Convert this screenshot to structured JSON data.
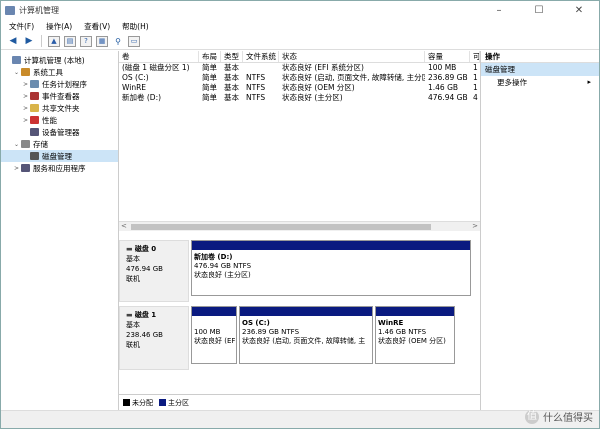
{
  "window": {
    "title": "计算机管理",
    "min": "–",
    "max": "☐",
    "close": "✕"
  },
  "menu": [
    "文件(F)",
    "操作(A)",
    "查看(V)",
    "帮助(H)"
  ],
  "tree": [
    {
      "label": "计算机管理 (本地)",
      "indent": 0,
      "exp": "",
      "color": "#6a86b0",
      "icon": "computer-icon"
    },
    {
      "label": "系统工具",
      "indent": 1,
      "exp": "⌄",
      "color": "#c98b2a",
      "icon": "tools-icon"
    },
    {
      "label": "任务计划程序",
      "indent": 2,
      "exp": ">",
      "color": "#6b8cae",
      "icon": "clock-icon"
    },
    {
      "label": "事件查看器",
      "indent": 2,
      "exp": ">",
      "color": "#a33",
      "icon": "event-icon"
    },
    {
      "label": "共享文件夹",
      "indent": 2,
      "exp": ">",
      "color": "#d9b44a",
      "icon": "folder-icon"
    },
    {
      "label": "性能",
      "indent": 2,
      "exp": ">",
      "color": "#c33",
      "icon": "performance-icon"
    },
    {
      "label": "设备管理器",
      "indent": 2,
      "exp": "",
      "color": "#557",
      "icon": "device-icon"
    },
    {
      "label": "存储",
      "indent": 1,
      "exp": "⌄",
      "color": "#888",
      "icon": "storage-icon"
    },
    {
      "label": "磁盘管理",
      "indent": 2,
      "exp": "",
      "color": "#555",
      "icon": "disk-icon",
      "selected": true
    },
    {
      "label": "服务和应用程序",
      "indent": 1,
      "exp": ">",
      "color": "#557",
      "icon": "services-icon"
    }
  ],
  "volume_headers": [
    "卷",
    "布局",
    "类型",
    "文件系统",
    "状态",
    "容量",
    "可"
  ],
  "volumes": [
    [
      "(磁盘 1 磁盘分区 1)",
      "简单",
      "基本",
      "",
      "状态良好 (EFI 系统分区)",
      "100 MB",
      "1"
    ],
    [
      "OS (C:)",
      "简单",
      "基本",
      "NTFS",
      "状态良好 (启动, 页面文件, 故障转储, 主分区)",
      "236.89 GB",
      "1"
    ],
    [
      "WinRE",
      "简单",
      "基本",
      "NTFS",
      "状态良好 (OEM 分区)",
      "1.46 GB",
      "1"
    ],
    [
      "新加卷 (D:)",
      "简单",
      "基本",
      "NTFS",
      "状态良好 (主分区)",
      "476.94 GB",
      "4"
    ]
  ],
  "disks": [
    {
      "name": "磁盘 0",
      "type": "基本",
      "size": "476.94 GB",
      "status": "联机",
      "partitions": [
        {
          "name": "新加卷  (D:)",
          "info": "476.94 GB NTFS",
          "status": "状态良好 (主分区)"
        }
      ]
    },
    {
      "name": "磁盘 1",
      "type": "基本",
      "size": "238.46 GB",
      "status": "联机",
      "partitions": [
        {
          "name": "",
          "info": "100 MB",
          "status": "状态良好 (EF"
        },
        {
          "name": "OS  (C:)",
          "info": "236.89 GB NTFS",
          "status": "状态良好 (启动, 页面文件, 故障转储, 主"
        },
        {
          "name": "WinRE",
          "info": "1.46 GB NTFS",
          "status": "状态良好 (OEM 分区)"
        }
      ]
    }
  ],
  "legend": [
    {
      "label": "未分配",
      "color": "#000000"
    },
    {
      "label": "主分区",
      "color": "#0a1a80"
    }
  ],
  "actions": {
    "header": "操作",
    "sub": "磁盘管理",
    "more": "更多操作",
    "more_arrow": "▸"
  },
  "watermark": {
    "text": "什么值得买",
    "glyph": "值"
  }
}
